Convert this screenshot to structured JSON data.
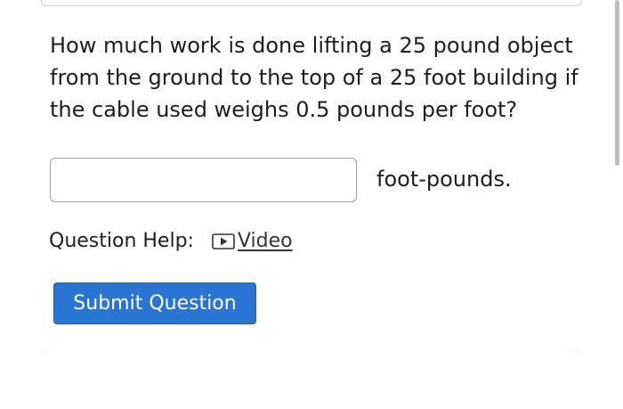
{
  "question": {
    "text": "How much work is done lifting a 25 pound object\nfrom the ground to the top of a 25 foot building if\nthe cable used weighs 0.5 pounds per foot?"
  },
  "answer": {
    "value": "",
    "placeholder": "",
    "units": "foot-pounds."
  },
  "help": {
    "label": "Question Help:",
    "video_icon": "play-video-icon",
    "video_label": "Video"
  },
  "actions": {
    "submit_label": "Submit Question"
  },
  "colors": {
    "submit_bg": "#2a75d3",
    "text": "#1d1d1d",
    "input_border": "#9e9e9e"
  }
}
